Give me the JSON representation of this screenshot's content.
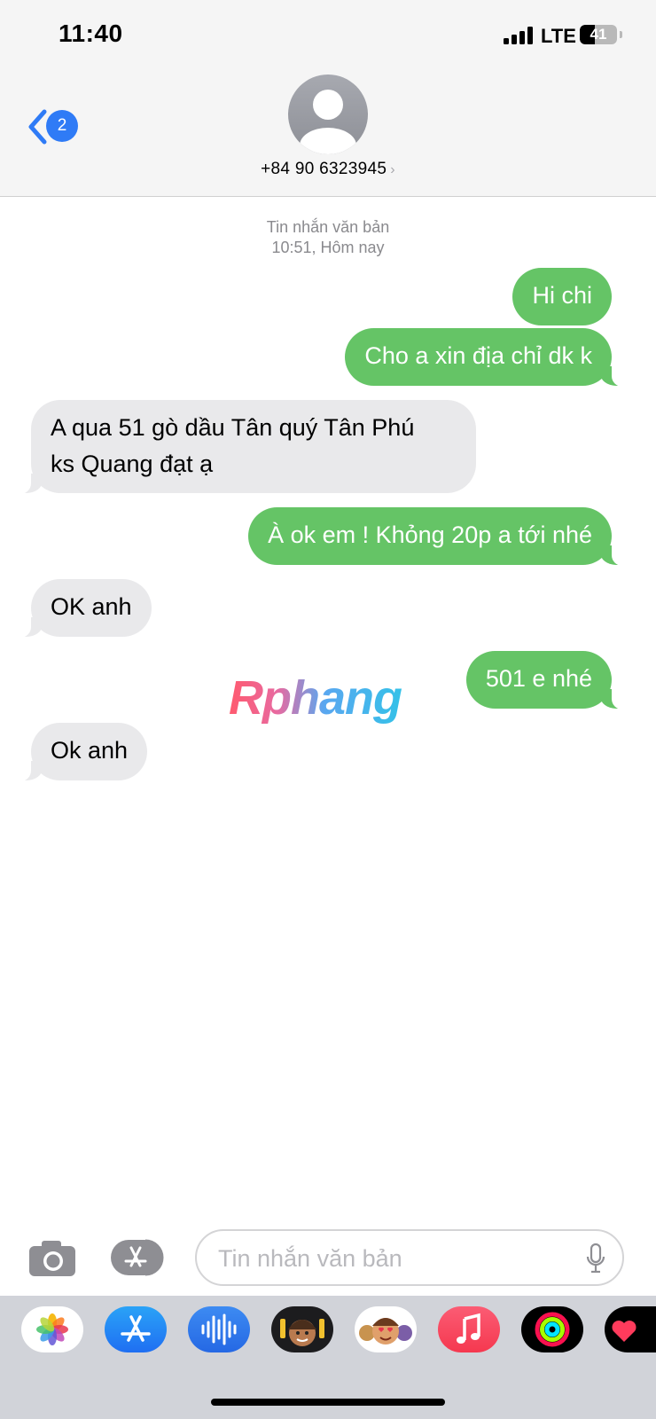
{
  "status_bar": {
    "time": "11:40",
    "carrier": "LTE",
    "battery": "41",
    "battery_percent": 41
  },
  "header": {
    "back_badge": "2",
    "contact": "+84 90 6323945",
    "avatar_icon": "person-silhouette-icon"
  },
  "thread": {
    "meta_line1": "Tin nhắn văn bản",
    "meta_line2": "10:51, Hôm nay",
    "messages": [
      {
        "direction": "out",
        "text": "Hi chi"
      },
      {
        "direction": "out",
        "text": "Cho a xin địa chỉ dk k"
      },
      {
        "direction": "in",
        "lines": [
          "A qua 51 gò dầu Tân quý Tân Phú",
          "ks Quang đạt ạ"
        ]
      },
      {
        "direction": "out",
        "text": "À ok em ! Khỏng 20p a tới nhé"
      },
      {
        "direction": "in",
        "text": "OK anh"
      },
      {
        "direction": "out",
        "text": "501 e nhé"
      },
      {
        "direction": "in",
        "text": "Ok anh"
      }
    ]
  },
  "watermark": "Rphang",
  "compose": {
    "placeholder": "Tin nhắn văn bản"
  },
  "colors": {
    "outgoing": "#65c466",
    "incoming": "#e9e9eb",
    "accent": "#2f7bf6"
  },
  "app_drawer": [
    {
      "icon": "photos-icon"
    },
    {
      "icon": "app-store-icon"
    },
    {
      "icon": "audio-message-icon"
    },
    {
      "icon": "memoji-icon"
    },
    {
      "icon": "memoji-stickers-icon"
    },
    {
      "icon": "music-icon"
    },
    {
      "icon": "activity-icon"
    },
    {
      "icon": "heart-sticker-icon"
    }
  ]
}
